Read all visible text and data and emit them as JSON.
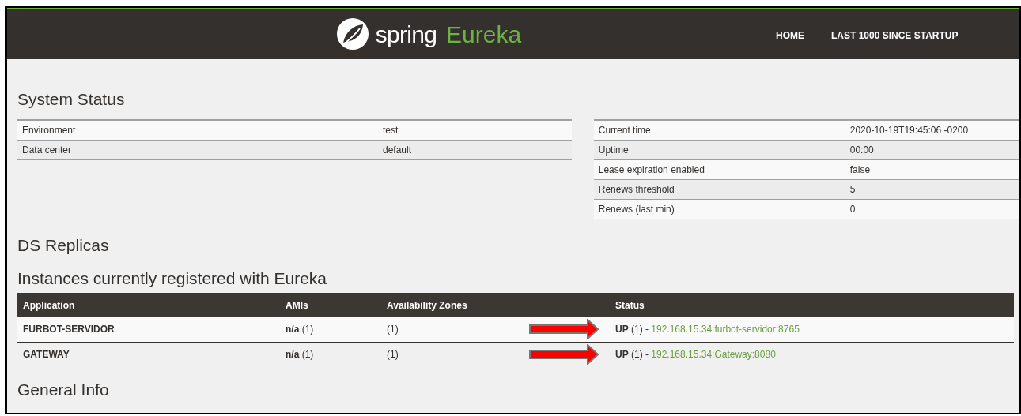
{
  "header": {
    "brand": "spring",
    "product": "Eureka",
    "nav": [
      "HOME",
      "LAST 1000 SINCE STARTUP"
    ]
  },
  "system_status": {
    "title": "System Status",
    "left": [
      {
        "label": "Environment",
        "value": "test"
      },
      {
        "label": "Data center",
        "value": "default"
      }
    ],
    "right": [
      {
        "label": "Current time",
        "value": "2020-10-19T19:45:06 -0200"
      },
      {
        "label": "Uptime",
        "value": "00:00"
      },
      {
        "label": "Lease expiration enabled",
        "value": "false"
      },
      {
        "label": "Renews threshold",
        "value": "5"
      },
      {
        "label": "Renews (last min)",
        "value": "0"
      }
    ]
  },
  "ds_replicas": {
    "title": "DS Replicas"
  },
  "instances": {
    "title": "Instances currently registered with Eureka",
    "columns": [
      "Application",
      "AMIs",
      "Availability Zones",
      "Status"
    ],
    "rows": [
      {
        "application": "FURBOT-SERVIDOR",
        "amis": "**n/a** (1)",
        "zones": "(1)",
        "status": "**UP** (1) - ",
        "link": "192.168.15.34:furbot-servidor:8765",
        "marked": true
      },
      {
        "application": "GATEWAY",
        "amis": "**n/a** (1)",
        "zones": "(1)",
        "status": "**UP** (1) - ",
        "link": "192.168.15.34:Gateway:8080",
        "marked": true
      }
    ]
  },
  "general_info": {
    "title": "General Info"
  }
}
